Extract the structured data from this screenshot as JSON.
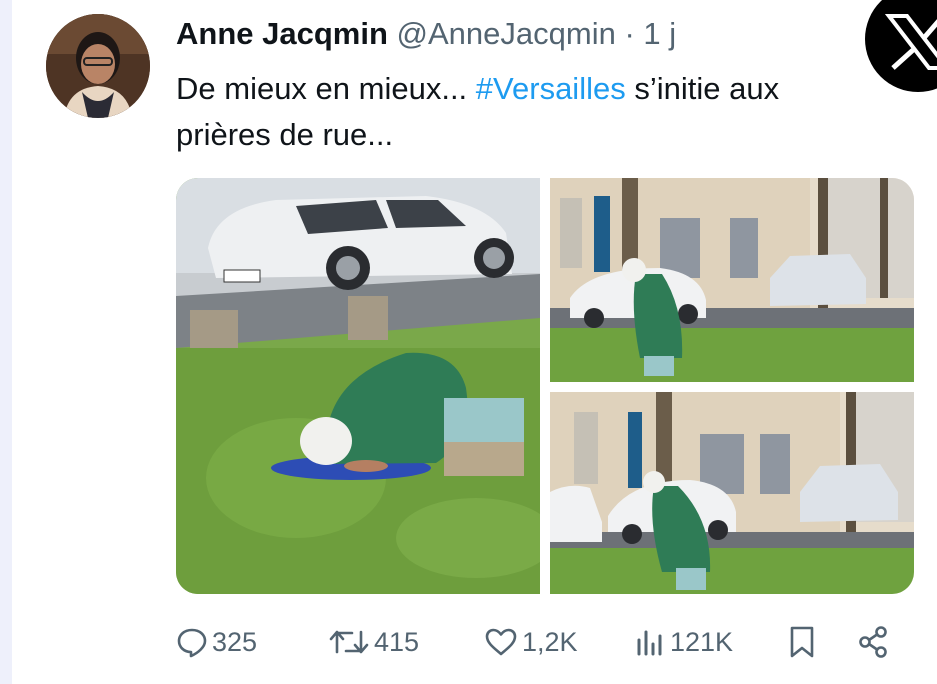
{
  "tweet": {
    "author_name": "Anne Jacqmin",
    "handle": "@AnneJacqmin",
    "separator": "·",
    "time": "1 j",
    "text_before": "De mieux en mieux... ",
    "hashtag": "#Versailles",
    "text_after": " s’initie aux prières de rue..."
  },
  "actions": {
    "replies": "325",
    "reposts": "415",
    "likes": "1,2K",
    "views": "121K"
  },
  "icons": {
    "platform": "x-logo-icon",
    "reply": "speech-bubble-icon",
    "repost": "repost-arrows-icon",
    "like": "heart-icon",
    "views": "bar-chart-icon",
    "bookmark": "bookmark-icon",
    "share": "share-icon"
  },
  "colors": {
    "text": "#0f1419",
    "secondary": "#536471",
    "hashtag": "#1d9bf0",
    "background": "#eef0fb"
  }
}
